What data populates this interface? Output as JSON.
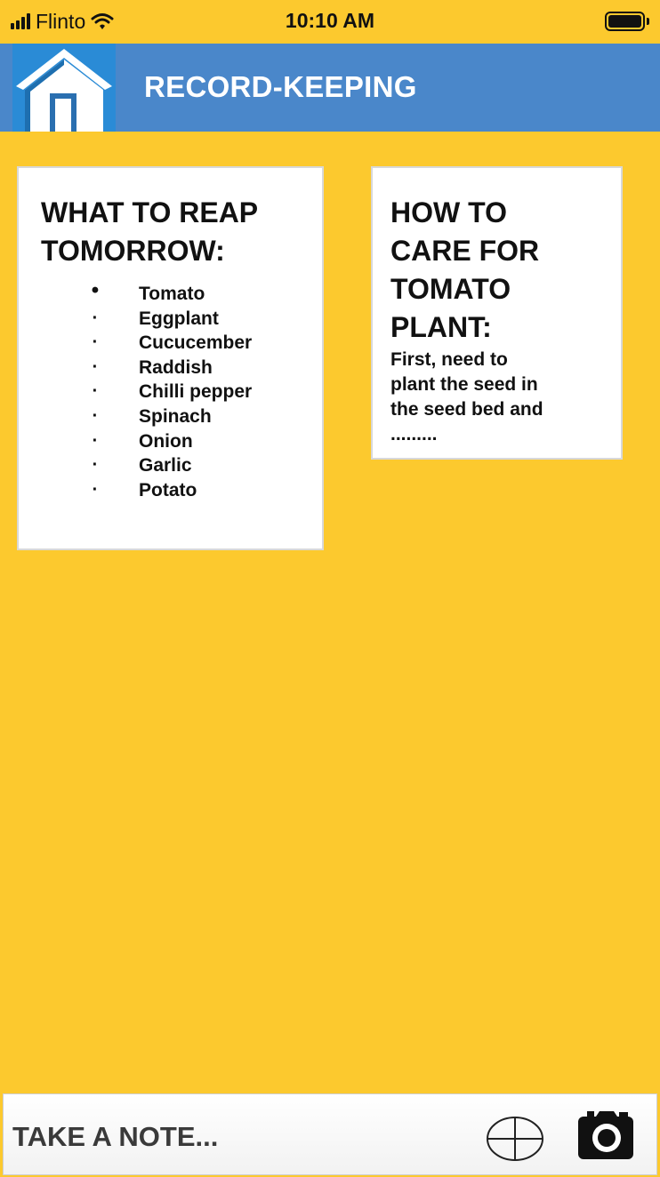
{
  "status_bar": {
    "carrier": "Flinto",
    "time": "10:10 AM"
  },
  "header": {
    "title": "RECORD-KEEPING",
    "home_icon": "house-icon"
  },
  "reap_card": {
    "title_line1": "WHAT TO REAP",
    "title_line2": "TOMORROW:",
    "items": [
      "Tomato",
      "Eggplant",
      "Cucucember",
      "Raddish",
      "Chilli pepper",
      "Spinach",
      "Onion",
      "Garlic",
      "Potato"
    ]
  },
  "care_card": {
    "title_line1": "HOW TO",
    "title_line2": "CARE FOR",
    "title_line3": "TOMATO",
    "title_line4": "PLANT:",
    "body_line1": "First, need to",
    "body_line2": "plant the seed in",
    "body_line3": "the seed bed and",
    "body_line4": "........."
  },
  "bottom_bar": {
    "note_label": "TAKE A NOTE...",
    "add_icon": "plus-circle-icon",
    "camera_icon": "camera-icon"
  },
  "colors": {
    "background": "#FCC92E",
    "header": "#4A87CA",
    "home_tile": "#2A8BD6",
    "card": "#FFFFFF"
  }
}
